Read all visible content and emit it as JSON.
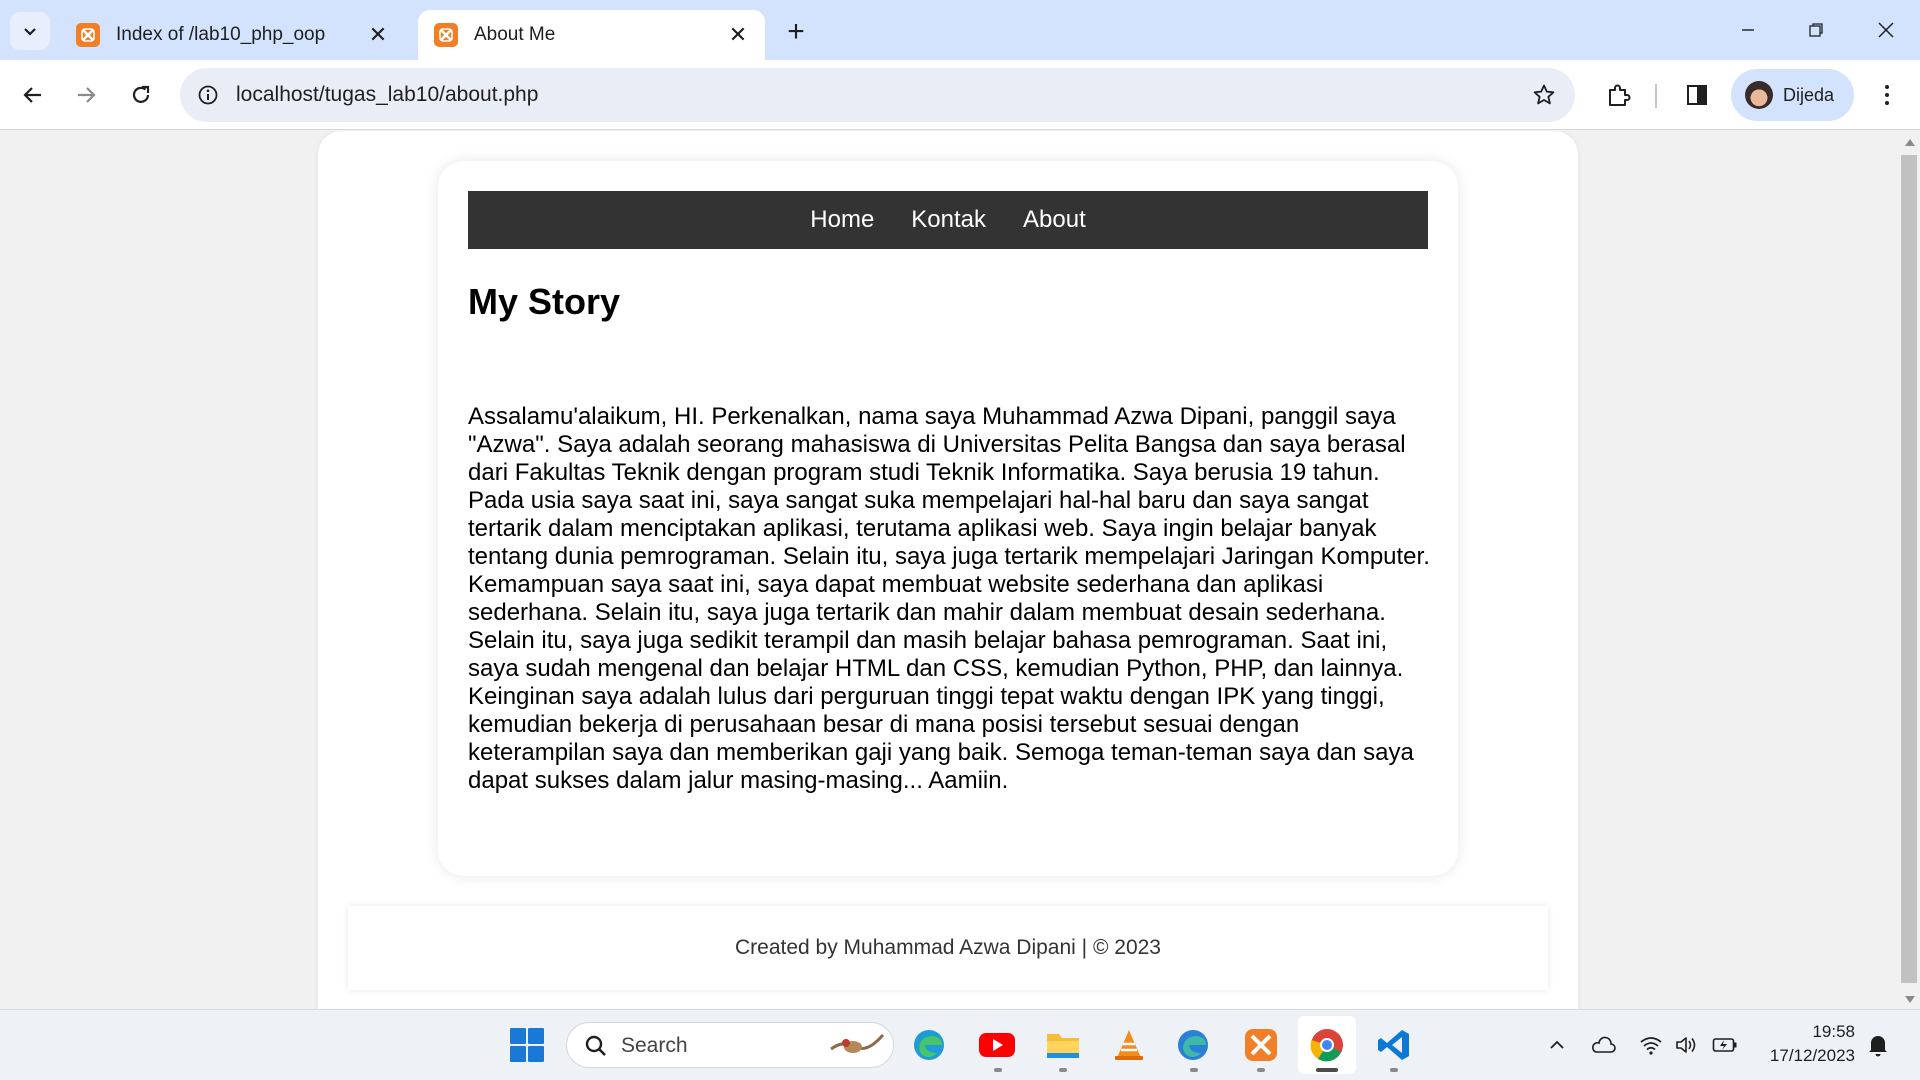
{
  "browser": {
    "tabs": [
      {
        "title": "Index of /lab10_php_oop",
        "active": false
      },
      {
        "title": "About Me",
        "active": true
      }
    ],
    "address_url": "localhost/tugas_lab10/about.php",
    "profile_name": "Dijeda"
  },
  "site": {
    "nav": [
      "Home",
      "Kontak",
      "About"
    ],
    "heading": "My Story",
    "story": "Assalamu'alaikum, HI. Perkenalkan, nama saya Muhammad Azwa Dipani, panggil saya \"Azwa\". Saya adalah seorang mahasiswa di Universitas Pelita Bangsa dan saya berasal dari Fakultas Teknik dengan program studi Teknik Informatika. Saya berusia 19 tahun. Pada usia saya saat ini, saya sangat suka mempelajari hal-hal baru dan saya sangat tertarik dalam menciptakan aplikasi, terutama aplikasi web. Saya ingin belajar banyak tentang dunia pemrograman. Selain itu, saya juga tertarik mempelajari Jaringan Komputer. Kemampuan saya saat ini, saya dapat membuat website sederhana dan aplikasi sederhana. Selain itu, saya juga tertarik dan mahir dalam membuat desain sederhana. Selain itu, saya juga sedikit terampil dan masih belajar bahasa pemrograman. Saat ini, saya sudah mengenal dan belajar HTML dan CSS, kemudian Python, PHP, dan lainnya. Keinginan saya adalah lulus dari perguruan tinggi tepat waktu dengan IPK yang tinggi, kemudian bekerja di perusahaan besar di mana posisi tersebut sesuai dengan keterampilan saya dan memberikan gaji yang baik. Semoga teman-teman saya dan saya dapat sukses dalam jalur masing-masing... Aamiin.",
    "footer": "Created by Muhammad Azwa Dipani | © 2023"
  },
  "taskbar": {
    "search_placeholder": "Search",
    "clock_time": "19:58",
    "clock_date": "17/12/2023"
  },
  "colors": {
    "tabstrip": "#d3e3fd",
    "nav_bar": "#333333",
    "xampp_orange": "#f07f27"
  }
}
